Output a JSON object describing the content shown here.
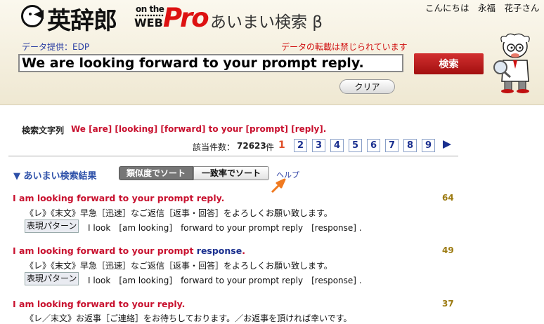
{
  "header": {
    "logo_kanji": "英辞郎",
    "logo_onthe": "on the",
    "logo_web": "WEB",
    "logo_pro": "Pro",
    "subtitle": "あいまい検索 β",
    "greeting": "こんにちは　永福　花子さん",
    "provider": "データ提供：EDP",
    "notice": "データの転載は禁じられています"
  },
  "search": {
    "value": "We are looking forward to your prompt reply.",
    "button_label": "検索",
    "clear_label": "クリア"
  },
  "query": {
    "label": "検索文字列",
    "text": "We [are] [looking] [forward] to your [prompt] [reply]."
  },
  "summary": {
    "count_label": "該当件数：",
    "count_value": "72623",
    "count_unit": "件",
    "current_page": "1",
    "pages": [
      "2",
      "3",
      "4",
      "5",
      "6",
      "7",
      "8",
      "9"
    ]
  },
  "results_panel": {
    "heading": "▼ あいまい検索結果",
    "sort_similarity": "類似度でソート",
    "sort_match": "一致率でソート",
    "help": "ヘルプ"
  },
  "results": [
    {
      "title_red": "I am looking forward to your prompt reply",
      "title_blue": "",
      "title_end": ".",
      "score": "64",
      "japanese": "《レ》《末文》早急［迅速］なご返信［返事・回答］をよろしくお願い致します。",
      "pattern_label": "表現パターン",
      "pattern": "I look　[am looking]　forward to your prompt reply　[response] ."
    },
    {
      "title_red": "I am looking forward to your prompt ",
      "title_blue": "response",
      "title_end": ".",
      "score": "49",
      "japanese": "《レ》《末文》早急［迅速］なご返信［返事・回答］をよろしくお願い致します。",
      "pattern_label": "表現パターン",
      "pattern": "I look　[am looking]　forward to your prompt reply　[response] ."
    },
    {
      "title_red": "I am looking forward to your reply",
      "title_blue": "",
      "title_end": ".",
      "score": "37",
      "japanese": "《レ／末文》お返事［ご連絡］をお待ちしております。／お返事を頂ければ幸いです。"
    }
  ]
}
